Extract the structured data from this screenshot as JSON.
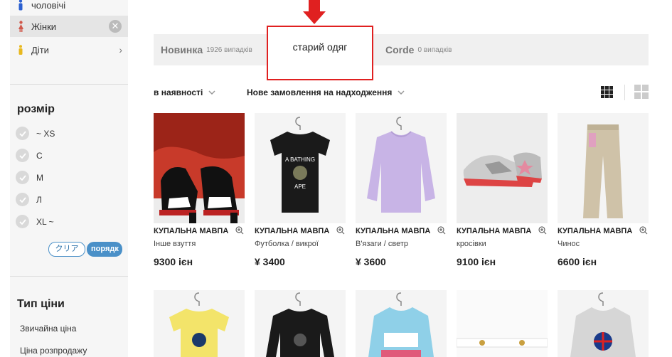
{
  "sidebar": {
    "categories": [
      {
        "label": "чоловічі"
      },
      {
        "label": "Жінки",
        "clear": "✕"
      },
      {
        "label": "Діти",
        "chevron": "›"
      }
    ],
    "size": {
      "title": "розмір",
      "options": [
        "~ XS",
        "С",
        "М",
        "Л",
        "XL ~"
      ],
      "clear_label": "クリア",
      "apply_label": "порядк"
    },
    "price_type": {
      "title": "Тип ціни",
      "options": [
        "Звичайна ціна",
        "Ціна розпродажу"
      ]
    }
  },
  "tabs": [
    {
      "label": "Новинка",
      "count": "1926 випадків"
    },
    {
      "label": "старий одяг",
      "count": ""
    },
    {
      "label": "Corde",
      "count": "0 випадків"
    }
  ],
  "filters": {
    "availability": "в наявності",
    "sort": "Нове замовлення на надходження"
  },
  "products": [
    {
      "name": "КУПАЛЬНА МАВПА",
      "category": "Інше взуття",
      "price": "9300 ієн"
    },
    {
      "name": "КУПАЛЬНА МАВПА",
      "category": "Футболка / викрої",
      "price": "¥ 3400"
    },
    {
      "name": "КУПАЛЬНА МАВПА",
      "category": "В'язаги / светр",
      "price": "¥ 3600"
    },
    {
      "name": "КУПАЛЬНА МАВПА",
      "category": "кросівки",
      "price": "9100 ієн"
    },
    {
      "name": "КУПАЛЬНА МАВПА",
      "category": "Чинос",
      "price": "6600 ієн"
    }
  ],
  "colors": {
    "accent_blue": "#4a90c8",
    "highlight_red": "#e02020",
    "male_icon": "#2b5fd0",
    "female_icon": "#d0584a",
    "kids_icon": "#e8b81e"
  },
  "icons": {
    "view_grid_dense": "grid-3x3-icon",
    "view_grid_large": "grid-2x2-icon",
    "zoom": "magnifier-plus-icon",
    "annotation": "red-down-arrow"
  }
}
